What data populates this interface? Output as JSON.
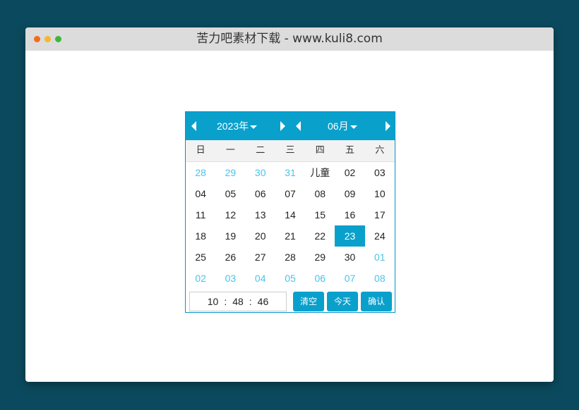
{
  "window": {
    "title": "苦力吧素材下载 - www.kuli8.com"
  },
  "calendar": {
    "year_label": "2023年",
    "month_label": "06月",
    "weekdays": [
      "日",
      "一",
      "二",
      "三",
      "四",
      "五",
      "六"
    ],
    "days": [
      {
        "t": "28",
        "other": true
      },
      {
        "t": "29",
        "other": true
      },
      {
        "t": "30",
        "other": true
      },
      {
        "t": "31",
        "other": true
      },
      {
        "t": "儿童",
        "other": false
      },
      {
        "t": "02",
        "other": false
      },
      {
        "t": "03",
        "other": false
      },
      {
        "t": "04",
        "other": false
      },
      {
        "t": "05",
        "other": false
      },
      {
        "t": "06",
        "other": false
      },
      {
        "t": "07",
        "other": false
      },
      {
        "t": "08",
        "other": false
      },
      {
        "t": "09",
        "other": false
      },
      {
        "t": "10",
        "other": false
      },
      {
        "t": "11",
        "other": false
      },
      {
        "t": "12",
        "other": false
      },
      {
        "t": "13",
        "other": false
      },
      {
        "t": "14",
        "other": false
      },
      {
        "t": "15",
        "other": false
      },
      {
        "t": "16",
        "other": false
      },
      {
        "t": "17",
        "other": false
      },
      {
        "t": "18",
        "other": false
      },
      {
        "t": "19",
        "other": false
      },
      {
        "t": "20",
        "other": false
      },
      {
        "t": "21",
        "other": false
      },
      {
        "t": "22",
        "other": false
      },
      {
        "t": "23",
        "other": false,
        "selected": true
      },
      {
        "t": "24",
        "other": false
      },
      {
        "t": "25",
        "other": false
      },
      {
        "t": "26",
        "other": false
      },
      {
        "t": "27",
        "other": false
      },
      {
        "t": "28",
        "other": false
      },
      {
        "t": "29",
        "other": false
      },
      {
        "t": "30",
        "other": false
      },
      {
        "t": "01",
        "other": true
      },
      {
        "t": "02",
        "other": true
      },
      {
        "t": "03",
        "other": true
      },
      {
        "t": "04",
        "other": true
      },
      {
        "t": "05",
        "other": true
      },
      {
        "t": "06",
        "other": true
      },
      {
        "t": "07",
        "other": true
      },
      {
        "t": "08",
        "other": true
      }
    ],
    "time": {
      "hour": "10",
      "minute": "48",
      "second": "46",
      "sep": ":"
    },
    "buttons": {
      "clear": "清空",
      "today": "今天",
      "confirm": "确认"
    }
  },
  "colors": {
    "accent": "#0aa0cc",
    "other_month": "#49c4e8",
    "background": "#0b4a5e"
  }
}
